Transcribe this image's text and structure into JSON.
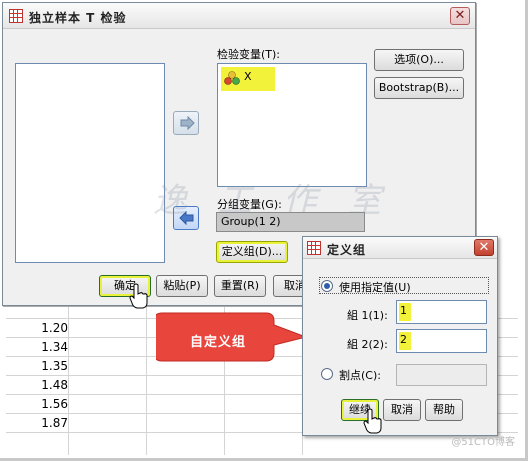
{
  "sheet": {
    "values": [
      "1.20",
      "1.34",
      "1.35",
      "1.48",
      "1.56",
      "1.87"
    ]
  },
  "main_dialog": {
    "title": "独立样本 T 检验",
    "test_var_label": "检验变量(T):",
    "test_var_item": "X",
    "group_var_label": "分组变量(G):",
    "group_var_value": "Group(1 2)",
    "buttons": {
      "options": "选项(O)...",
      "bootstrap": "Bootstrap(B)...",
      "define_groups": "定义组(D)...",
      "ok": "确定",
      "paste": "粘贴(P)",
      "reset": "重置(R)",
      "cancel": "取消"
    },
    "watermark": "逸  工 作 室"
  },
  "sub_dialog": {
    "title": "定义组",
    "use_specified_label": "使用指定值(U)",
    "group1_label": "組 1(1):",
    "group1_value": "1",
    "group2_label": "組 2(2):",
    "group2_value": "2",
    "cutpoint_label": "割点(C):",
    "continue_label": "继续",
    "cancel_label": "取消",
    "help_label": "帮助"
  },
  "callout": {
    "text": "自定义组",
    "color": "#e8453c"
  },
  "footer": {
    "mark": "@51CTO博客"
  },
  "colors": {
    "highlight": "#f2f23a",
    "close_red": "#c3402e"
  }
}
